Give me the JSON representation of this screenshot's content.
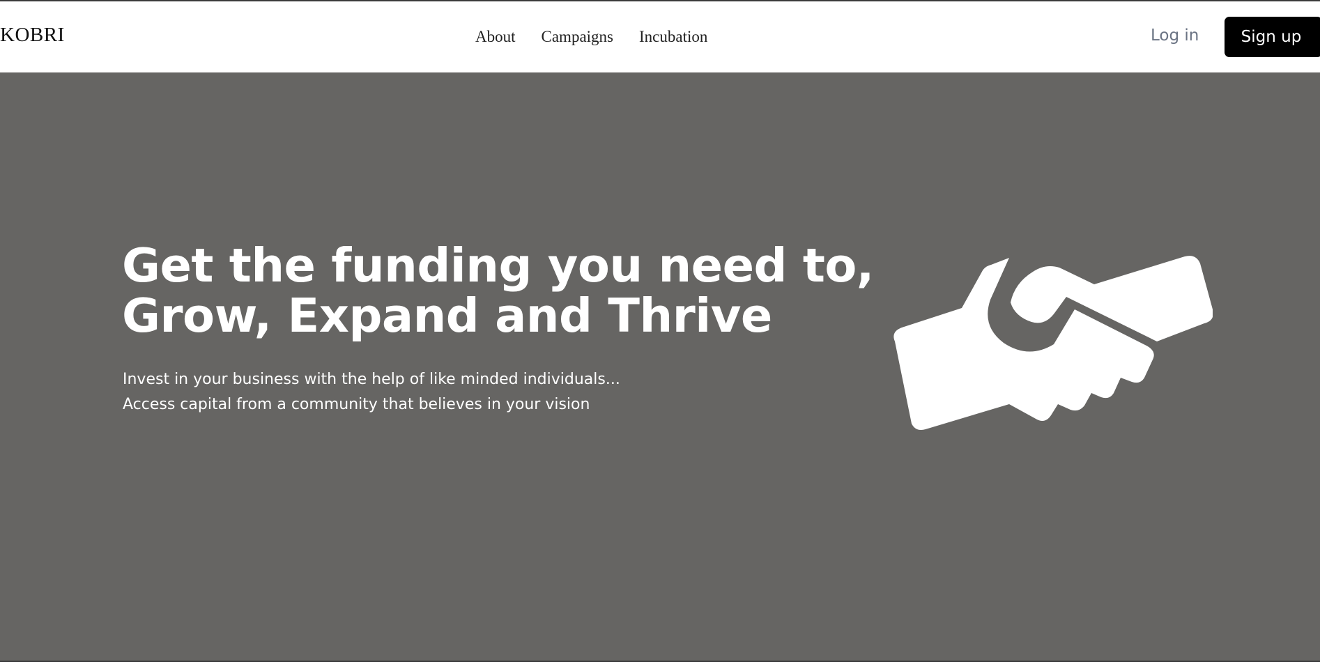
{
  "header": {
    "logo": "KOBRI",
    "nav": [
      {
        "label": "About"
      },
      {
        "label": "Campaigns"
      },
      {
        "label": "Incubation"
      }
    ],
    "login_label": "Log in",
    "signup_label": "Sign up"
  },
  "hero": {
    "headline_line1": "Get the funding you need to,",
    "headline_line2": "Grow, Expand and Thrive",
    "sub_line1": "Invest in your business with the help of like minded individuals...",
    "sub_line2": "Access capital from a community that believes in your vision",
    "icon": "handshake-icon",
    "background_color": "#666563"
  },
  "colors": {
    "signup_bg": "#000000",
    "login_text": "#6a7383"
  }
}
